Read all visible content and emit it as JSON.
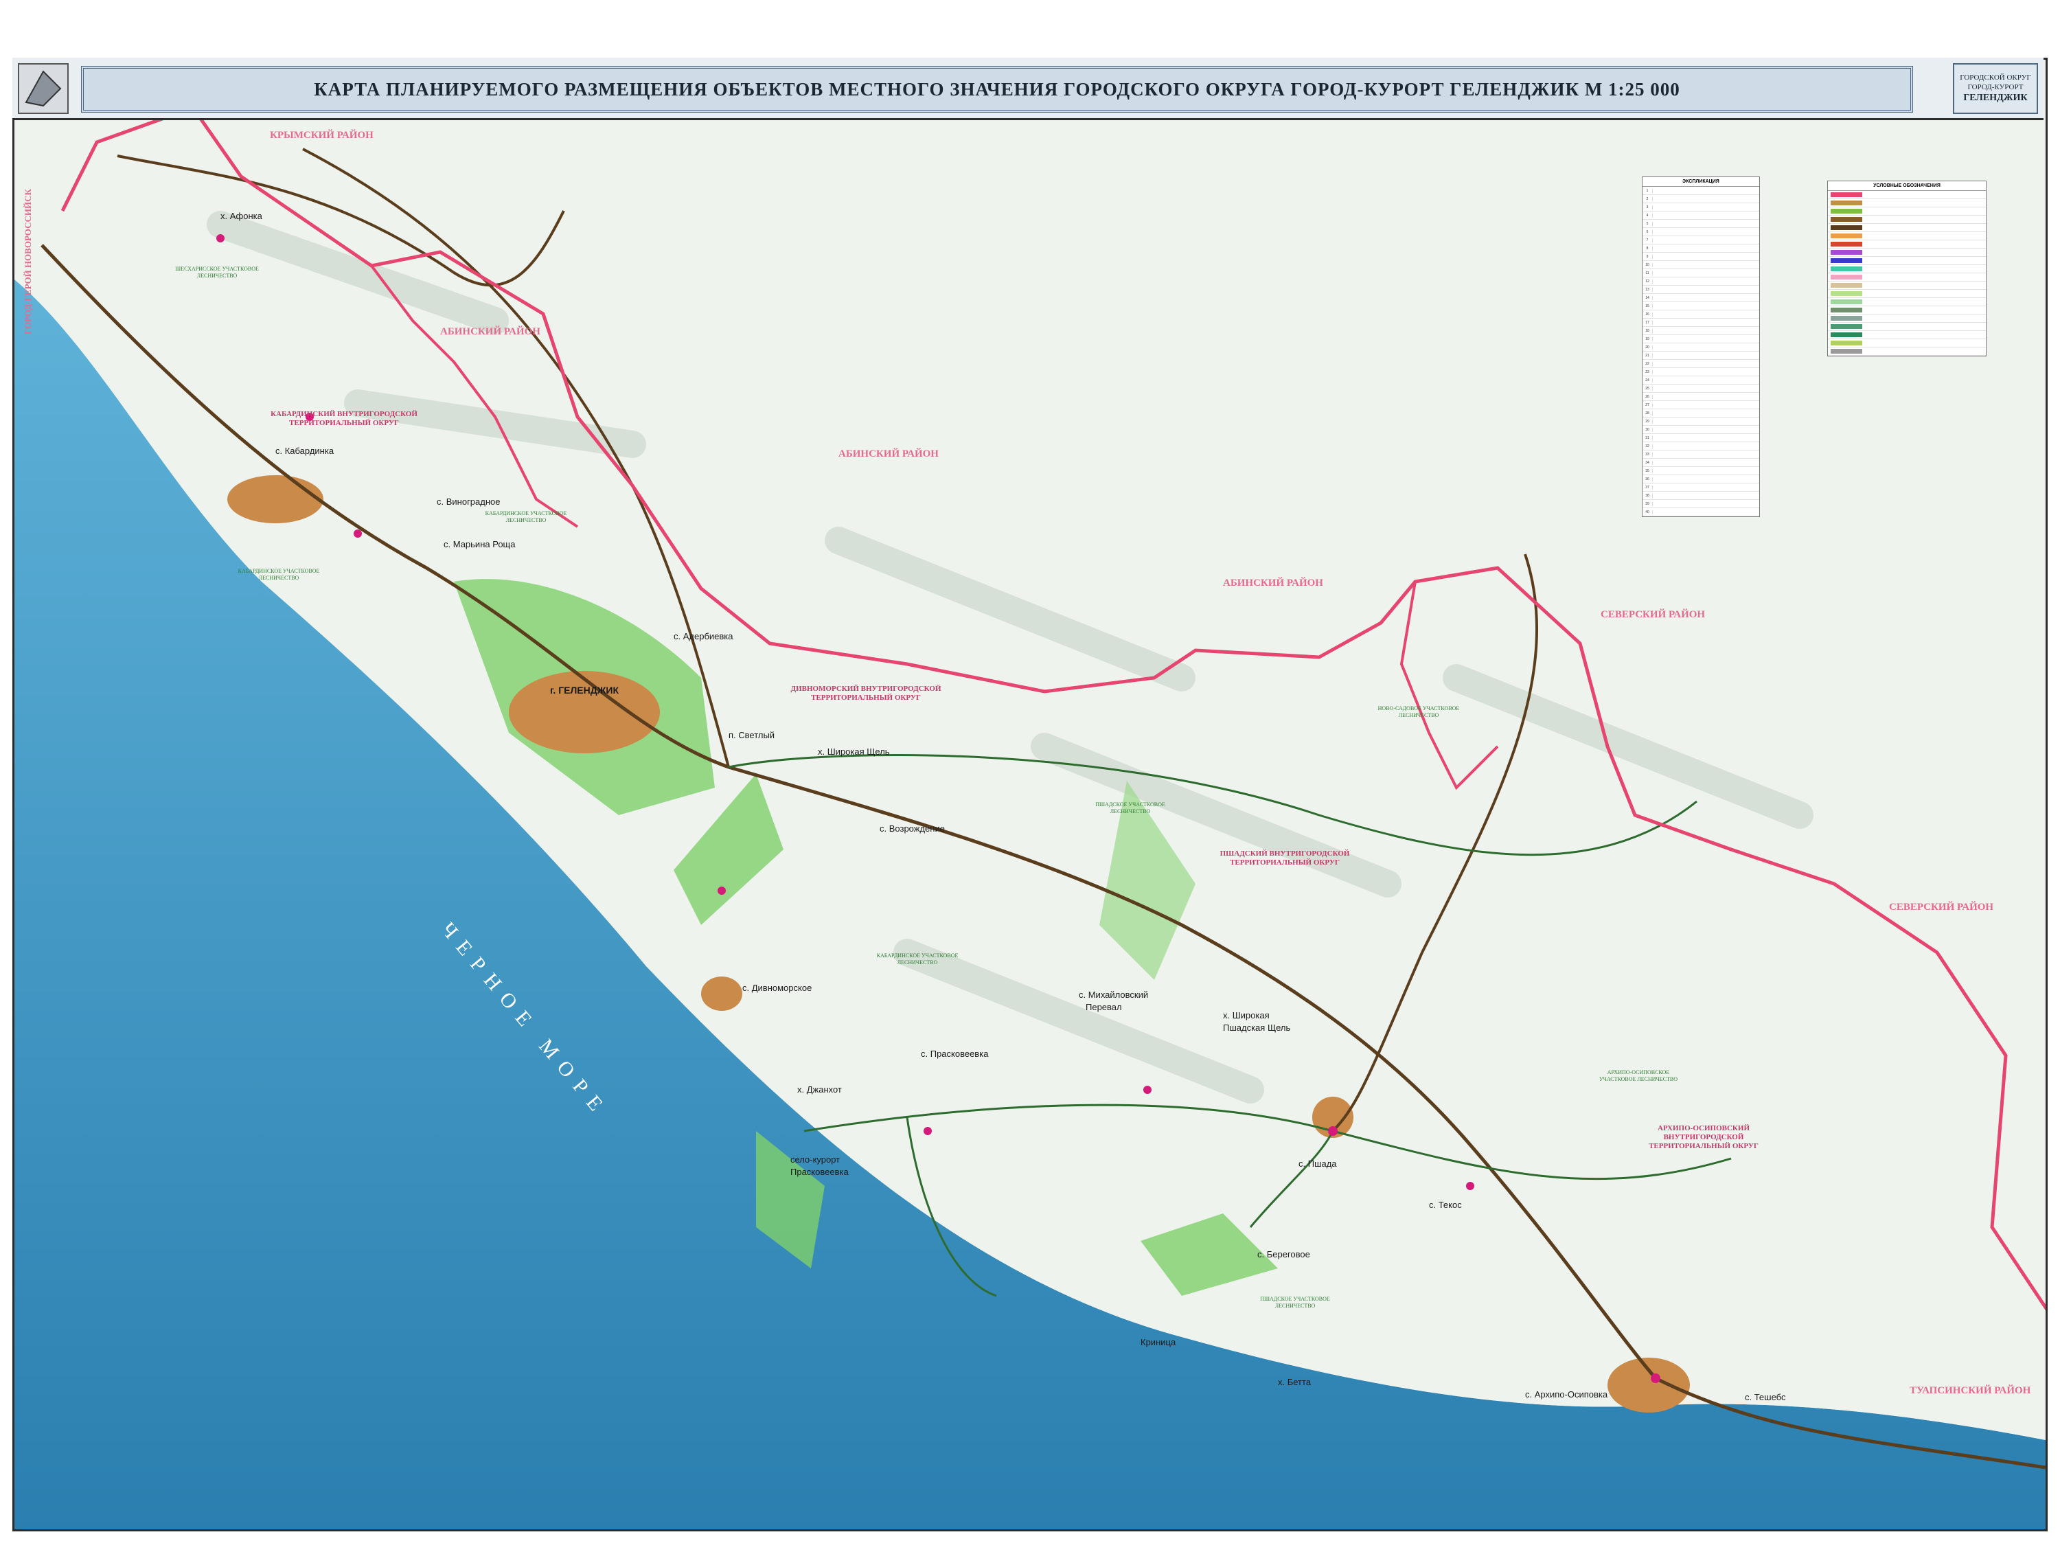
{
  "title": "КАРТА ПЛАНИРУЕМОГО РАЗМЕЩЕНИЯ ОБЪЕКТОВ МЕСТНОГО ЗНАЧЕНИЯ ГОРОДСКОГО ОКРУГА ГОРОД-КУРОРТ ГЕЛЕНДЖИК М 1:25 000",
  "badge": {
    "line1": "ГОРОДСКОЙ ОКРУГ",
    "line2": "ГОРОД-КУРОРТ",
    "line3": "ГЕЛЕНДЖИК"
  },
  "sea_label": "ЧЕРНОЕ МОРЕ",
  "districts": {
    "krymsky": "КРЫМСКИЙ РАЙОН",
    "abinsky_1": "АБИНСКИЙ РАЙОН",
    "abinsky_2": "АБИНСКИЙ РАЙОН",
    "abinsky_3": "АБИНСКИЙ РАЙОН",
    "seversky_1": "СЕВЕРСКИЙ РАЙОН",
    "seversky_2": "СЕВЕРСКИЙ РАЙОН",
    "tuapsinsky": "ТУАПСИНСКИЙ РАЙОН",
    "novorossiysk": "ГОРОД-ГЕРОЙ НОВОРОССИЙСК"
  },
  "zones": {
    "kabardinsky": "КАБАРДИНСКИЙ ВНУТРИГОРОДСКОЙ ТЕРРИТОРИАЛЬНЫЙ ОКРУГ",
    "divnomorsky": "ДИВНОМОРСКИЙ ВНУТРИГОРОДСКОЙ ТЕРРИТОРИАЛЬНЫЙ ОКРУГ",
    "pshadsky": "ПШАДСКИЙ ВНУТРИГОРОДСКОЙ ТЕРРИТОРИАЛЬНЫЙ ОКРУГ",
    "arkhipo": "АРХИПО-ОСИПОВСКИЙ ВНУТРИГОРОДСКОЙ ТЕРРИТОРИАЛЬНЫЙ ОКРУГ"
  },
  "forestry": {
    "f1": "ШЕСХАРИССКОЕ УЧАСТКОВОЕ ЛЕСНИЧЕСТВО",
    "f2": "КАБАРДИНСКОЕ УЧАСТКОВОЕ ЛЕСНИЧЕСТВО",
    "f3": "КАБАРДИНСКОЕ УЧАСТКОВОЕ ЛЕСНИЧЕСТВО",
    "f4": "ПШАДСКОЕ УЧАСТКОВОЕ ЛЕСНИЧЕСТВО",
    "f5": "КАБАРДИНСКОЕ УЧАСТКОВОЕ ЛЕСНИЧЕСТВО",
    "f6": "НОВО-САДОВОЕ УЧАСТКОВОЕ ЛЕСНИЧЕСТВО",
    "f7": "АРХИПО-ОСИПОВСКОЕ УЧАСТКОВОЕ ЛЕСНИЧЕСТВО",
    "f8": "ПШАДСКОЕ УЧАСТКОВОЕ ЛЕСНИЧЕСТВО"
  },
  "settlements": {
    "afonka": "х. Афонка",
    "kabardinka": "с. Кабардинка",
    "vinogradnoe": "с. Виноградное",
    "maryina_roshcha": "с. Марьина Роща",
    "gelendzhik": "г. ГЕЛЕНДЖИК",
    "aderbievka": "с. Адербиевка",
    "svetly": "п. Светлый",
    "shirokaya_shchel": "х. Широкая Щель",
    "vozrozhdenie": "с. Возрождение",
    "divnomorskoe": "с. Дивноморское",
    "praskoveevka": "с. Прасковеевка",
    "dzhankhot": "х. Джанхот",
    "selo_kurort_1": "село-курорт",
    "selo_kurort_2": "Прасковеевка",
    "mikhailovsky_1": "с. Михайловский",
    "mikhailovsky_2": "Перевал",
    "pshadskaya_1": "х. Широкая",
    "pshadskaya_2": "Пшадская Щель",
    "pshada": "с. Пшада",
    "tekos": "с. Текос",
    "beregovoe": "с. Береговое",
    "krinitsa": "Криница",
    "betta": "х. Бетта",
    "arkhipo_osipovka": "с. Архипо-Осиповка",
    "teshebs": "с. Тешебс"
  },
  "legend_table": {
    "title": "ЭКСПЛИКАЦИЯ",
    "rows": [
      "1",
      "2",
      "3",
      "4",
      "5",
      "6",
      "7",
      "8",
      "9",
      "10",
      "11",
      "12",
      "13",
      "14",
      "15",
      "16",
      "17",
      "18",
      "19",
      "20",
      "21",
      "22",
      "23",
      "24",
      "25",
      "26",
      "27",
      "28",
      "29",
      "30",
      "31",
      "32",
      "33",
      "34",
      "35",
      "36",
      "37",
      "38",
      "39",
      "40"
    ]
  },
  "legend_symbols": {
    "title": "УСЛОВНЫЕ ОБОЗНАЧЕНИЯ",
    "swatches": [
      "#e6456f",
      "#c08f4a",
      "#7fbf3f",
      "#8b5a2b",
      "#5a3d1c",
      "#e8a14a",
      "#d8452e",
      "#a44bd1",
      "#3a3ad1",
      "#3fc9a5",
      "#f2a5c2",
      "#d6c39a",
      "#b7e08a",
      "#9fd7a0",
      "#6f8f6f",
      "#8aa39a",
      "#4c9b73",
      "#2e8a5c",
      "#b0d060",
      "#999999"
    ]
  },
  "colors": {
    "sea": "#2f88b8",
    "boundary": "#e6456f",
    "road_main": "#5a3d1c",
    "road_local": "#2e6b2e",
    "park": "#7fcf6a",
    "urban": "#c98a4a"
  }
}
